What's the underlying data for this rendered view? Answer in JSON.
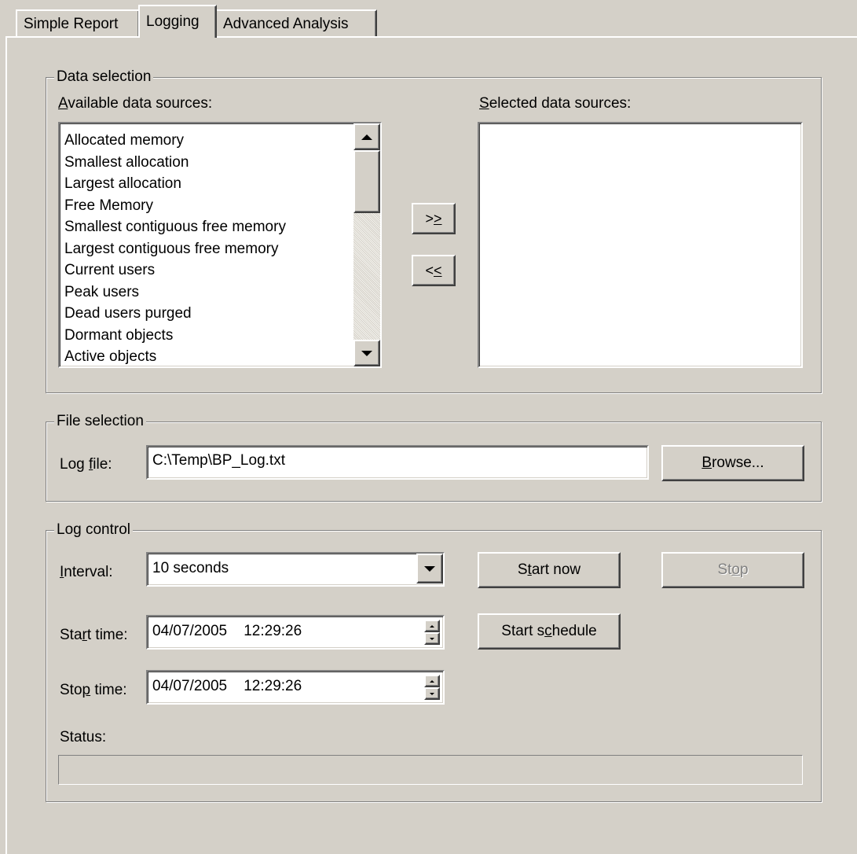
{
  "tabs": [
    {
      "label": "Simple Report"
    },
    {
      "label": "Logging"
    },
    {
      "label": "Advanced Analysis"
    }
  ],
  "data_selection": {
    "title": "Data selection",
    "available_label_first": "A",
    "available_label_rest": "vailable data sources:",
    "selected_label_first": "S",
    "selected_label_rest": "elected data sources:",
    "available_items": [
      "Allocated memory",
      "Smallest allocation",
      "Largest allocation",
      "Free Memory",
      "Smallest contiguous free memory",
      "Largest contiguous free memory",
      "Current users",
      "Peak users",
      "Dead users purged",
      "Dormant objects",
      "Active objects"
    ],
    "add_button_a": ">",
    "add_button_b": ">",
    "remove_button_a": "<",
    "remove_button_b": "<"
  },
  "file_selection": {
    "title": "File selection",
    "log_label_a": "Log ",
    "log_label_u": "f",
    "log_label_b": "ile:",
    "log_file_value": "C:\\Temp\\BP_Log.txt",
    "browse_u": "B",
    "browse_rest": "rowse..."
  },
  "log_control": {
    "title": "Log control",
    "interval_u": "I",
    "interval_rest": "nterval:",
    "interval_value": "10 seconds",
    "start_now_a": "S",
    "start_now_u": "t",
    "start_now_b": "art now",
    "stop_a": "St",
    "stop_u": "o",
    "stop_b": "p",
    "start_time_a": "Sta",
    "start_time_u": "r",
    "start_time_b": "t time:",
    "start_time_value": "04/07/2005    12:29:26",
    "start_schedule_a": "Start s",
    "start_schedule_u": "c",
    "start_schedule_b": "hedule",
    "stop_time_a": "Sto",
    "stop_time_u": "p",
    "stop_time_b": " time:",
    "stop_time_value": "04/07/2005    12:29:26",
    "status_label": "Status:",
    "status_value": ""
  }
}
